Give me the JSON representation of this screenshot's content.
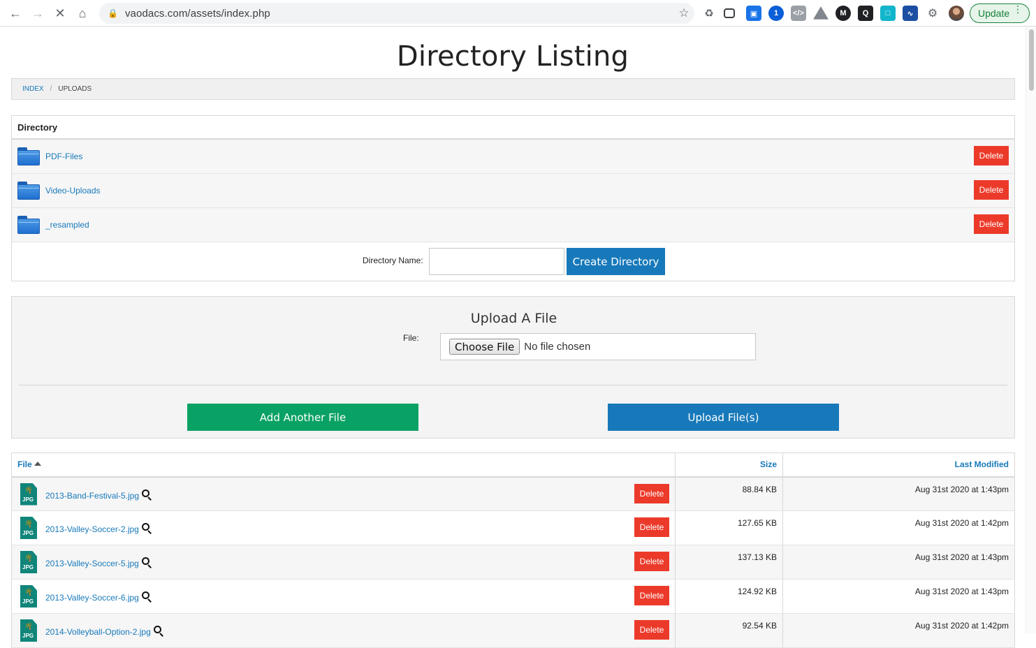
{
  "browser": {
    "url": "vaodacs.com/assets/index.php",
    "update_label": "Update"
  },
  "page": {
    "title": "Directory Listing"
  },
  "breadcrumb": {
    "index": "INDEX",
    "separator": "/",
    "current": "UPLOADS"
  },
  "directory": {
    "header": "Directory",
    "items": [
      {
        "name": "PDF-Files",
        "delete_label": "Delete"
      },
      {
        "name": "Video-Uploads",
        "delete_label": "Delete"
      },
      {
        "name": "_resampled",
        "delete_label": "Delete"
      }
    ],
    "name_label": "Directory Name:",
    "name_value": "",
    "create_label": "Create Directory"
  },
  "upload": {
    "title": "Upload A File",
    "file_label": "File:",
    "choose_label": "Choose File",
    "no_file_text": "No file chosen",
    "add_label": "Add Another File",
    "upload_label": "Upload File(s)"
  },
  "files": {
    "columns": {
      "file": "File",
      "size": "Size",
      "modified": "Last Modified"
    },
    "sort": {
      "column": "file",
      "direction": "ascending"
    },
    "rows": [
      {
        "name": "2013-Band-Festival-5.jpg",
        "size": "88.84 KB",
        "modified": "Aug 31st 2020 at 1:43pm",
        "delete_label": "Delete"
      },
      {
        "name": "2013-Valley-Soccer-2.jpg",
        "size": "127.65 KB",
        "modified": "Aug 31st 2020 at 1:42pm",
        "delete_label": "Delete"
      },
      {
        "name": "2013-Valley-Soccer-5.jpg",
        "size": "137.13 KB",
        "modified": "Aug 31st 2020 at 1:43pm",
        "delete_label": "Delete"
      },
      {
        "name": "2013-Valley-Soccer-6.jpg",
        "size": "124.92 KB",
        "modified": "Aug 31st 2020 at 1:43pm",
        "delete_label": "Delete"
      },
      {
        "name": "2014-Volleyball-Option-2.jpg",
        "size": "92.54 KB",
        "modified": "Aug 31st 2020 at 1:42pm",
        "delete_label": "Delete"
      }
    ]
  },
  "icons": {
    "file_type": "JPG",
    "folder": "folder-icon",
    "preview": "magnify-icon"
  },
  "colors": {
    "accent": "#1779ba",
    "delete": "#ec3a2a",
    "add": "#0aa264"
  }
}
